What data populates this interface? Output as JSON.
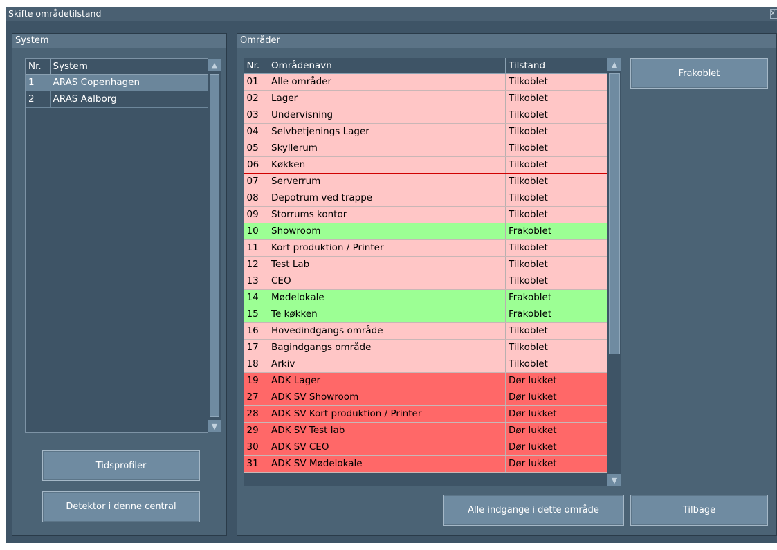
{
  "window": {
    "title": "Skifte områdetilstand",
    "close_glyph": "X"
  },
  "system_panel": {
    "header": "System",
    "columns": [
      "Nr.",
      "System"
    ],
    "rows": [
      {
        "nr": "1",
        "name": "ARAS Copenhagen"
      },
      {
        "nr": "2",
        "name": "ARAS Aalborg"
      }
    ],
    "selected_row": 0,
    "buttons": {
      "time_profiles": "Tidsprofiler",
      "detector": "Detektor i denne central"
    }
  },
  "areas_panel": {
    "header": "Områder",
    "columns": [
      "Nr.",
      "Områdenavn",
      "Tilstand"
    ],
    "rows": [
      {
        "nr": "01",
        "name": "Alle områder",
        "state": "Tilkoblet",
        "kind": "on"
      },
      {
        "nr": "02",
        "name": "Lager",
        "state": "Tilkoblet",
        "kind": "on"
      },
      {
        "nr": "03",
        "name": "Undervisning",
        "state": "Tilkoblet",
        "kind": "on"
      },
      {
        "nr": "04",
        "name": "Selvbetjenings Lager",
        "state": "Tilkoblet",
        "kind": "on"
      },
      {
        "nr": "05",
        "name": "Skyllerum",
        "state": "Tilkoblet",
        "kind": "on"
      },
      {
        "nr": "06",
        "name": "Køkken",
        "state": "Tilkoblet",
        "kind": "on"
      },
      {
        "nr": "07",
        "name": "Serverrum",
        "state": "Tilkoblet",
        "kind": "on"
      },
      {
        "nr": "08",
        "name": "Depotrum ved trappe",
        "state": "Tilkoblet",
        "kind": "on"
      },
      {
        "nr": "09",
        "name": "Storrums kontor",
        "state": "Tilkoblet",
        "kind": "on"
      },
      {
        "nr": "10",
        "name": "Showroom",
        "state": "Frakoblet",
        "kind": "off"
      },
      {
        "nr": "11",
        "name": "Kort produktion / Printer",
        "state": "Tilkoblet",
        "kind": "on"
      },
      {
        "nr": "12",
        "name": "Test Lab",
        "state": "Tilkoblet",
        "kind": "on"
      },
      {
        "nr": "13",
        "name": "CEO",
        "state": "Tilkoblet",
        "kind": "on"
      },
      {
        "nr": "14",
        "name": "Mødelokale",
        "state": "Frakoblet",
        "kind": "off"
      },
      {
        "nr": "15",
        "name": "Te køkken",
        "state": "Frakoblet",
        "kind": "off"
      },
      {
        "nr": "16",
        "name": "Hovedindgangs område",
        "state": "Tilkoblet",
        "kind": "on"
      },
      {
        "nr": "17",
        "name": "Bagindgangs område",
        "state": "Tilkoblet",
        "kind": "on"
      },
      {
        "nr": "18",
        "name": "Arkiv",
        "state": "Tilkoblet",
        "kind": "on"
      },
      {
        "nr": "19",
        "name": "ADK Lager",
        "state": "Dør lukket",
        "kind": "door"
      },
      {
        "nr": "27",
        "name": "ADK SV Showroom",
        "state": "Dør lukket",
        "kind": "door"
      },
      {
        "nr": "28",
        "name": "ADK SV Kort produktion / Printer",
        "state": "Dør lukket",
        "kind": "door"
      },
      {
        "nr": "29",
        "name": "ADK SV Test lab",
        "state": "Dør lukket",
        "kind": "door"
      },
      {
        "nr": "30",
        "name": "ADK SV CEO",
        "state": "Dør lukket",
        "kind": "door"
      },
      {
        "nr": "31",
        "name": "ADK SV Mødelokale",
        "state": "Dør lukket",
        "kind": "door"
      }
    ],
    "focused_row": 5,
    "buttons": {
      "toggle_state": "Frakoblet",
      "all_entrances": "Alle indgange i dette område",
      "back": "Tilbage"
    }
  },
  "colors": {
    "state_on": "#ffc6c6",
    "state_off": "#9cff94",
    "state_door_closed": "#ff6868",
    "window_bg": "#3e5466",
    "panel_bg": "#4b6375"
  },
  "icons": {
    "scroll_up": "▲",
    "scroll_down": "▼"
  }
}
